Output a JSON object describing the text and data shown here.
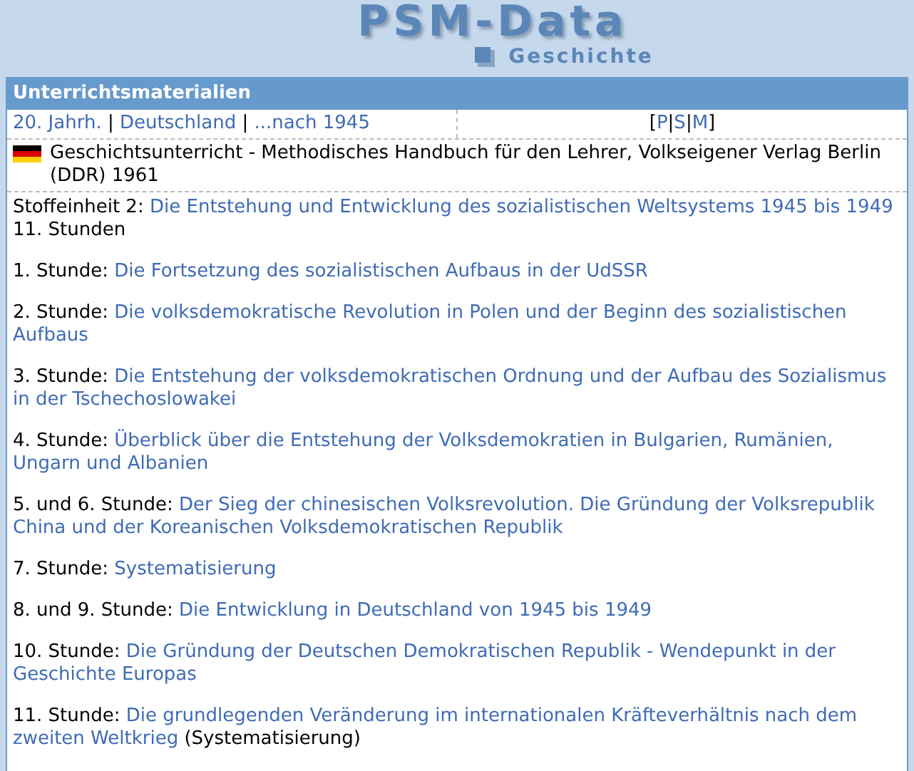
{
  "logo": {
    "title": "PSM-Data",
    "subtitle": "Geschichte"
  },
  "panel": {
    "title": "Unterrichtsmaterialien",
    "breadcrumb": {
      "separator": "|",
      "items": [
        "20. Jahrh.",
        "Deutschland",
        "...nach 1945"
      ]
    },
    "views": {
      "open": "[",
      "close": "]",
      "separator": "|",
      "links": [
        "P",
        "S",
        "M"
      ]
    },
    "source": {
      "text": "Geschichtsunterricht - Methodisches Handbuch für den Lehrer, Volkseigener Verlag Berlin (DDR) 1961"
    },
    "unit": {
      "label": "Stoffeinheit 2:",
      "title": "Die Entstehung und Entwicklung des sozialistischen Weltsystems 1945 bis 1949",
      "hours": "11. Stunden"
    },
    "lessons": [
      {
        "label": "1. Stunde:",
        "title": "Die Fortsetzung des sozialistischen Aufbaus in der UdSSR"
      },
      {
        "label": "2. Stunde:",
        "title": "Die volksdemokratische Revolution in Polen und der Beginn des sozialistischen Aufbaus"
      },
      {
        "label": "3. Stunde:",
        "title": "Die Entstehung der volksdemokratischen Ordnung und der Aufbau des Sozialismus in der Tschechoslowakei"
      },
      {
        "label": "4. Stunde:",
        "title": "Überblick über die Entstehung der Volksdemokratien in Bulgarien, Rumänien, Ungarn und Albanien"
      },
      {
        "label": "5. und 6. Stunde:",
        "title": "Der Sieg der chinesischen Volksrevolution. Die Gründung der Volksrepublik China und der Koreanischen Volksdemokratischen Republik"
      },
      {
        "label": "7. Stunde:",
        "title": "Systematisierung"
      },
      {
        "label": "8. und 9. Stunde:",
        "title": "Die Entwicklung in Deutschland von 1945 bis 1949"
      },
      {
        "label": "10. Stunde:",
        "title": "Die Gründung der Deutschen Demokratischen Republik - Wendepunkt in der Geschichte Europas"
      },
      {
        "label": "11. Stunde:",
        "title": "Die grundlegenden Veränderung im internationalen Kräfteverhältnis nach dem zweiten Weltkrieg",
        "note": "(Systematisierung)"
      }
    ]
  }
}
